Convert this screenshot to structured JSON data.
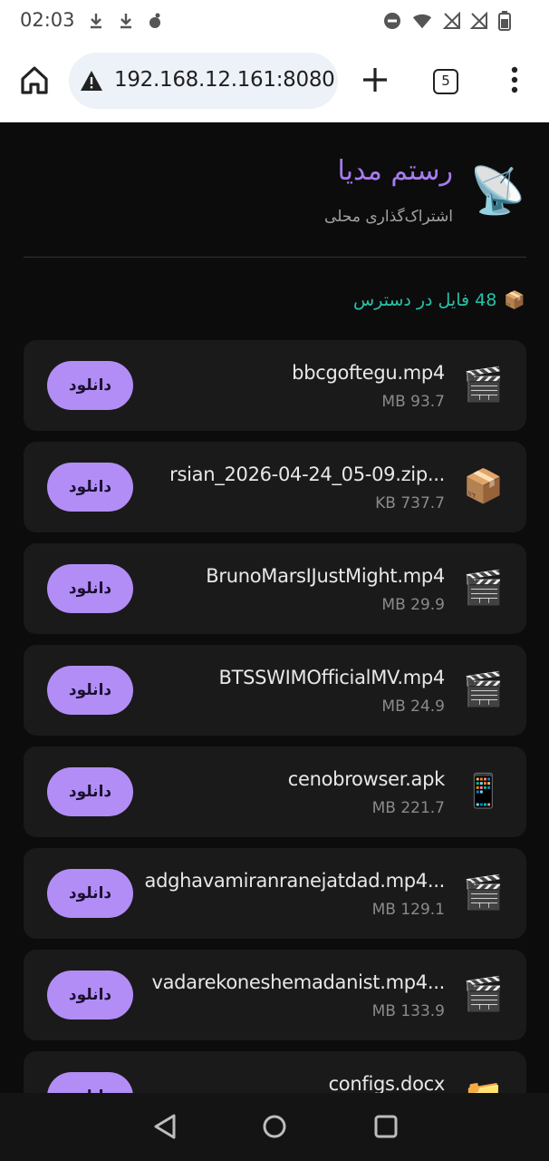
{
  "status": {
    "time": "02:03"
  },
  "browser": {
    "url": "192.168.12.161:8080",
    "tab_count": "5"
  },
  "app": {
    "title": "رستم مدیا",
    "subtitle": "اشتراک‌گذاری محلی",
    "logo_icon": "📡",
    "count_icon": "📦",
    "count_text": "48 فایل در دسترس",
    "accent": "#b28df6"
  },
  "files": [
    {
      "name": "bbcgoftegu.mp4",
      "size": "MB 93.7",
      "icon": "🎬",
      "button": "دانلود"
    },
    {
      "name": "rsian_2026-04-24_05-09.zip...",
      "size": "KB 737.7",
      "icon": "📦",
      "button": "دانلود"
    },
    {
      "name": "BrunoMarsIJustMight.mp4",
      "size": "MB 29.9",
      "icon": "🎬",
      "button": "دانلود"
    },
    {
      "name": "BTSSWIMOfficialMV.mp4",
      "size": "MB 24.9",
      "icon": "🎬",
      "button": "دانلود"
    },
    {
      "name": "cenobrowser.apk",
      "size": "MB 221.7",
      "icon": "📱",
      "button": "دانلود"
    },
    {
      "name": "adghavamiranranejatdad.mp4...",
      "size": "MB 129.1",
      "icon": "🎬",
      "button": "دانلود"
    },
    {
      "name": "vadarekoneshemadanist.mp4...",
      "size": "MB 133.9",
      "icon": "🎬",
      "button": "دانلود"
    },
    {
      "name": "configs.docx",
      "size": "",
      "icon": "📁",
      "button": "دانلود"
    }
  ]
}
